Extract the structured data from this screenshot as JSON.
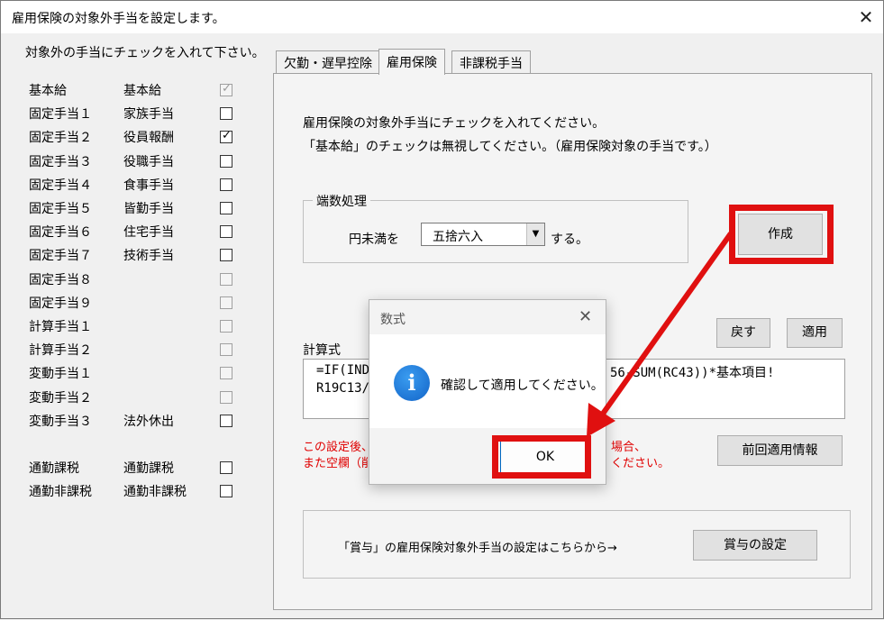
{
  "window": {
    "title": "雇用保険の対象外手当を設定します。",
    "close_glyph": "✕"
  },
  "left": {
    "instruction": "対象外の手当にチェックを入れて下さい。",
    "rows": [
      {
        "label": "基本給",
        "name": "基本給",
        "checked": true,
        "disabled": true
      },
      {
        "label": "固定手当１",
        "name": "家族手当",
        "checked": false,
        "disabled": false
      },
      {
        "label": "固定手当２",
        "name": "役員報酬",
        "checked": true,
        "disabled": false
      },
      {
        "label": "固定手当３",
        "name": "役職手当",
        "checked": false,
        "disabled": false
      },
      {
        "label": "固定手当４",
        "name": "食事手当",
        "checked": false,
        "disabled": false
      },
      {
        "label": "固定手当５",
        "name": "皆勤手当",
        "checked": false,
        "disabled": false
      },
      {
        "label": "固定手当６",
        "name": "住宅手当",
        "checked": false,
        "disabled": false
      },
      {
        "label": "固定手当７",
        "name": "技術手当",
        "checked": false,
        "disabled": false
      },
      {
        "label": "固定手当８",
        "name": "",
        "checked": false,
        "disabled": true
      },
      {
        "label": "固定手当９",
        "name": "",
        "checked": false,
        "disabled": true
      },
      {
        "label": "計算手当１",
        "name": "",
        "checked": false,
        "disabled": true
      },
      {
        "label": "計算手当２",
        "name": "",
        "checked": false,
        "disabled": true
      },
      {
        "label": "変動手当１",
        "name": "",
        "checked": false,
        "disabled": true
      },
      {
        "label": "変動手当２",
        "name": "",
        "checked": false,
        "disabled": true
      },
      {
        "label": "変動手当３",
        "name": "法外休出",
        "checked": false,
        "disabled": false
      }
    ],
    "commute_rows": [
      {
        "label": "通勤課税",
        "name": "通勤課税",
        "checked": false,
        "disabled": false
      },
      {
        "label": "通勤非課税",
        "name": "通勤非課税",
        "checked": false,
        "disabled": false
      }
    ],
    "check_glyph": "✓"
  },
  "tabs": [
    {
      "label": "欠勤・遅早控除",
      "active": false
    },
    {
      "label": "雇用保険",
      "active": true
    },
    {
      "label": "非課税手当",
      "active": false
    }
  ],
  "panel": {
    "desc1": "雇用保険の対象外手当にチェックを入れてください。",
    "desc2": "「基本給」のチェックは無視してください。（雇用保険対象の手当です。）",
    "rounding": {
      "legend": "端数処理",
      "prefix": "円未満を",
      "selected": "五捨六入",
      "suffix": "する。"
    },
    "create_button": "作成",
    "back_button": "戻す",
    "apply_button": "適用",
    "formula_label": "計算式",
    "formula_line1_a": "=IF(IND",
    "formula_line1_b": "56-SUM(RC43))*基本項目!",
    "formula_line2": "R19C13/",
    "warn1_a": "この設定後、",
    "warn1_b": "場合、",
    "warn2_a": "また空欄（削",
    "warn2_b": "ください。",
    "prev_info_button": "前回適用情報",
    "bonus_text": "「賞与」の雇用保険対象外手当の設定はこちらから→",
    "bonus_button": "賞与の設定"
  },
  "dialog": {
    "title": "数式",
    "close_glyph": "✕",
    "icon_glyph": "i",
    "message": "確認して適用してください。",
    "ok_button": "OK"
  },
  "colors": {
    "highlight": "#e01010",
    "warning_text": "#e00000",
    "info_icon": "#1a74d6"
  }
}
